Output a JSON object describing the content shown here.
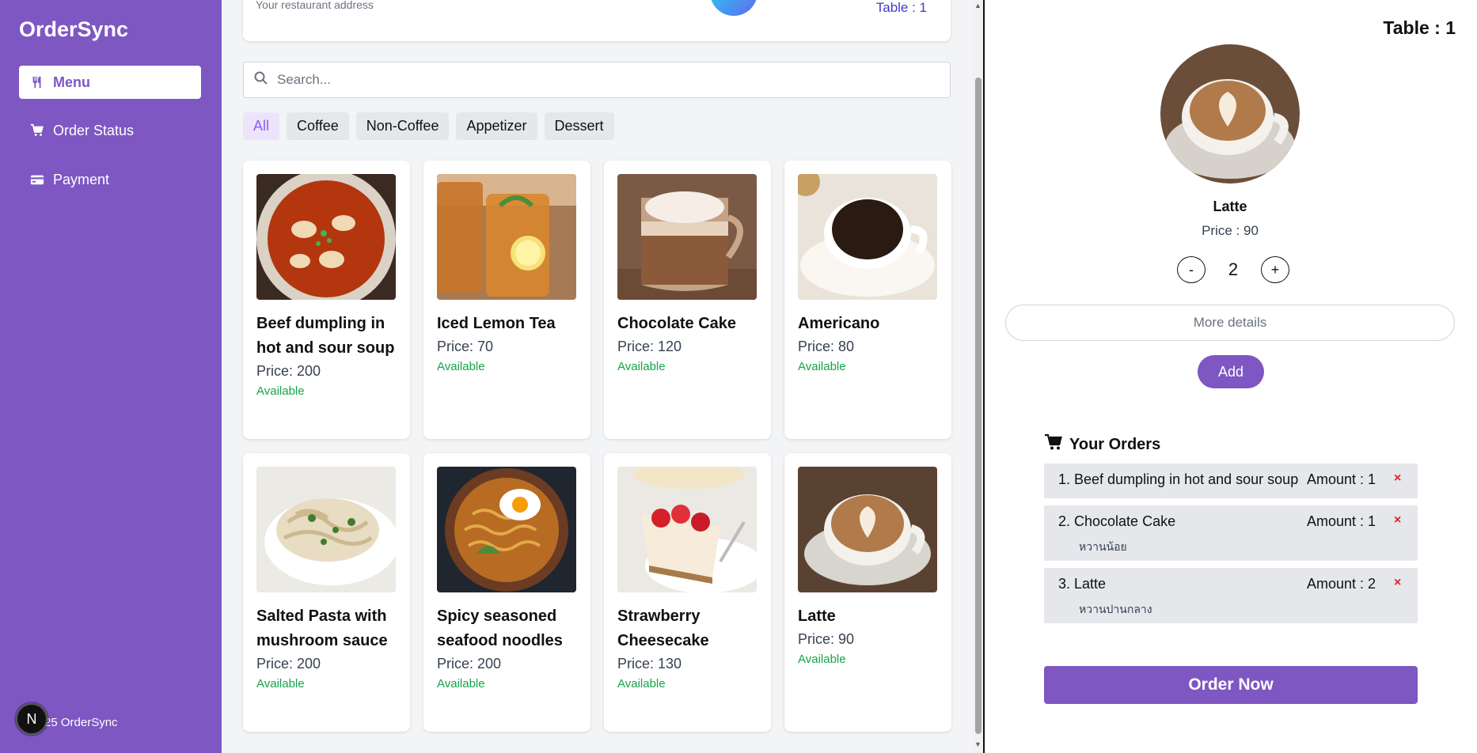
{
  "sidebar": {
    "brand": "OrderSync",
    "items": [
      {
        "label": "Menu",
        "icon": "utensils-icon",
        "active": true
      },
      {
        "label": "Order Status",
        "icon": "cart-icon",
        "active": false
      },
      {
        "label": "Payment",
        "icon": "credit-card-icon",
        "active": false
      }
    ],
    "footer": "25 OrderSync",
    "badge": "N"
  },
  "header": {
    "address": "Your restaurant address",
    "table": "Table : 1"
  },
  "search": {
    "placeholder": "Search..."
  },
  "categories": [
    "All",
    "Coffee",
    "Non-Coffee",
    "Appetizer",
    "Dessert"
  ],
  "menu": [
    {
      "name": "Beef dumpling in hot and sour soup",
      "price": "Price: 200",
      "status": "Available"
    },
    {
      "name": "Iced Lemon Tea",
      "price": "Price: 70",
      "status": "Available"
    },
    {
      "name": "Chocolate Cake",
      "price": "Price: 120",
      "status": "Available"
    },
    {
      "name": "Americano",
      "price": "Price: 80",
      "status": "Available"
    },
    {
      "name": "Salted Pasta with mushroom sauce",
      "price": "Price: 200",
      "status": "Available"
    },
    {
      "name": "Spicy seasoned seafood noodles",
      "price": "Price: 200",
      "status": "Available"
    },
    {
      "name": "Strawberry Cheesecake",
      "price": "Price: 130",
      "status": "Available"
    },
    {
      "name": "Latte",
      "price": "Price: 90",
      "status": "Available"
    }
  ],
  "panel": {
    "table": "Table : 1",
    "selected": {
      "name": "Latte",
      "price": "Price : 90",
      "quantity": "2",
      "minus": "-",
      "plus": "+",
      "details_placeholder": "More details",
      "add_label": "Add"
    },
    "orders_title": "Your Orders",
    "orders": [
      {
        "line": "1. Beef dumpling in hot and sour soup",
        "amount": "Amount : 1",
        "note": ""
      },
      {
        "line": "2. Chocolate Cake",
        "amount": "Amount : 1",
        "note": "หวานน้อย"
      },
      {
        "line": "3. Latte",
        "amount": "Amount : 2",
        "note": "หวานปานกลาง"
      }
    ],
    "remove_symbol": "×",
    "order_now": "Order Now"
  },
  "colors": {
    "primary": "#7e57c2",
    "available": "#16a34a",
    "remove": "#dc2626"
  }
}
